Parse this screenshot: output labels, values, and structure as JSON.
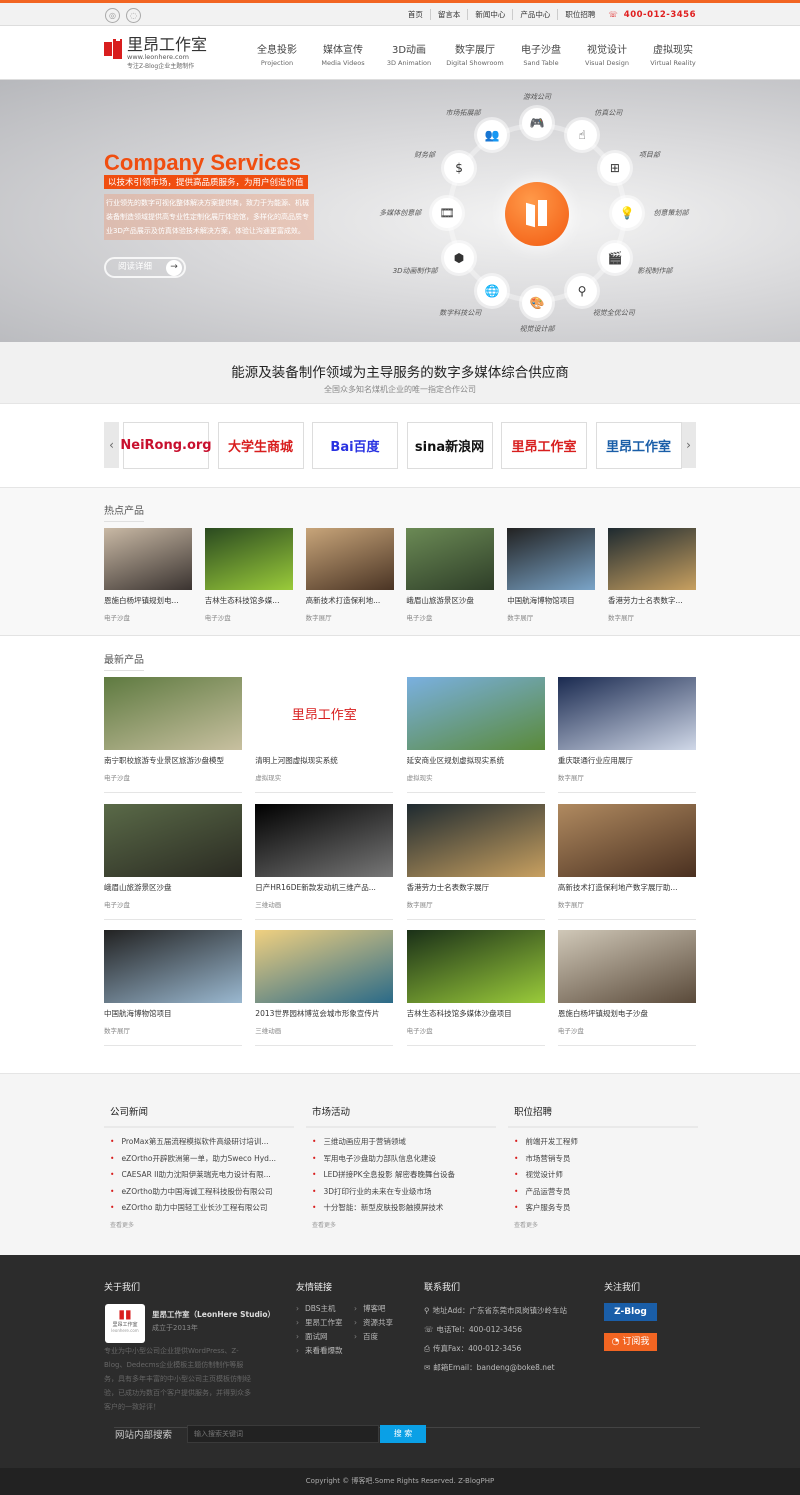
{
  "topbar": {
    "social": [
      {
        "icon": "weibo-icon",
        "glyph": "◎"
      },
      {
        "icon": "wechat-icon",
        "glyph": "◌"
      }
    ],
    "links": [
      "首页",
      "留言本",
      "新闻中心",
      "产品中心",
      "职位招聘"
    ],
    "phone_icon": "phone-icon",
    "phone": "400-012-3456"
  },
  "header": {
    "logo": {
      "name": "里昂工作室",
      "url": "www.leonhere.com",
      "tagline": "专注Z-Blog企业主题制作"
    },
    "nav": [
      {
        "zh": "全息投影",
        "en": "Projection"
      },
      {
        "zh": "媒体宣传",
        "en": "Media Videos"
      },
      {
        "zh": "3D动画",
        "en": "3D Animation"
      },
      {
        "zh": "数字展厅",
        "en": "Digital Showroom"
      },
      {
        "zh": "电子沙盘",
        "en": "Sand Table"
      },
      {
        "zh": "视觉设计",
        "en": "Visual Design"
      },
      {
        "zh": "虚拟现实",
        "en": "Virtual Reality"
      }
    ]
  },
  "banner": {
    "title": "Company Services",
    "subtitle": "以技术引领市场，提供高品质服务，为用户创造价值",
    "description": "行业领先的数字可视化整体解决方案提供商，致力于为能源、机械装备制造领域提供高专业性定制化展厅体验馆，多样化的高品质专业3D产品展示及仿真体验技术解决方案，体验让沟通更富成效。",
    "read_more": "阅读详细",
    "nodes": [
      {
        "label": "游戏公司",
        "icon": "gamepad-icon",
        "glyph": "🎮"
      },
      {
        "label": "仿真公司",
        "icon": "hand-pointer-icon",
        "glyph": "☝"
      },
      {
        "label": "项目部",
        "icon": "org-chart-icon",
        "glyph": "⊞"
      },
      {
        "label": "创意策划部",
        "icon": "lightbulb-icon",
        "glyph": "💡"
      },
      {
        "label": "影视制作部",
        "icon": "clapperboard-icon",
        "glyph": "🎬"
      },
      {
        "label": "视觉全优公司",
        "icon": "search-person-icon",
        "glyph": "⚲"
      },
      {
        "label": "视觉设计部",
        "icon": "palette-icon",
        "glyph": "🎨"
      },
      {
        "label": "数字科技公司",
        "icon": "globe-truck-icon",
        "glyph": "🌐"
      },
      {
        "label": "3D动画制作部",
        "icon": "cube-icon",
        "glyph": "⬢"
      },
      {
        "label": "多媒体创意部",
        "icon": "film-reel-icon",
        "glyph": "🎞"
      },
      {
        "label": "财务部",
        "icon": "money-bag-icon",
        "glyph": "$"
      },
      {
        "label": "市场拓展部",
        "icon": "people-chart-icon",
        "glyph": "👥"
      }
    ]
  },
  "slogan": {
    "heading": "能源及装备制作领域为主导服务的数字多媒体综合供应商",
    "sub": "全国众多知名煤机企业的唯一指定合作公司"
  },
  "partners": {
    "prev": "‹",
    "next": "›",
    "logos": [
      {
        "name": "NeiRong.org",
        "color": "#c8102e"
      },
      {
        "name": "大学生商城",
        "color": "#d81e1e"
      },
      {
        "name": "Bai百度",
        "color": "#2932e1"
      },
      {
        "name": "sina新浪网",
        "color": "#111"
      },
      {
        "name": "里昂工作室",
        "color": "#d81e1e"
      },
      {
        "name": "里昂工作室",
        "color": "#1a5ea8"
      }
    ]
  },
  "hot": {
    "title": "热点产品",
    "items": [
      {
        "title": "恩施白杨坪镇规划电...",
        "category": "电子沙盘",
        "colors": [
          "#c9b9a5",
          "#3a3330"
        ]
      },
      {
        "title": "吉林生态科技馆多媒...",
        "category": "电子沙盘",
        "colors": [
          "#2a4a20",
          "#9acb3a"
        ]
      },
      {
        "title": "高新技术打造保利地...",
        "category": "数字展厅",
        "colors": [
          "#c8a57a",
          "#4a3424"
        ]
      },
      {
        "title": "峨眉山旅游景区沙盘",
        "category": "电子沙盘",
        "colors": [
          "#6b8a55",
          "#2e3e28"
        ]
      },
      {
        "title": "中国航海博物馆项目",
        "category": "数字展厅",
        "colors": [
          "#222",
          "#7aa4c8"
        ]
      },
      {
        "title": "香港劳力士名表数字...",
        "category": "数字展厅",
        "colors": [
          "#1e2a30",
          "#c8a060"
        ]
      }
    ]
  },
  "latest": {
    "title": "最新产品",
    "items": [
      {
        "title": "南宁职校旅游专业景区旅游沙盘模型",
        "category": "电子沙盘",
        "colors": [
          "#5e7a40",
          "#c8c0a0"
        ]
      },
      {
        "title": "清明上河图虚拟现实系统",
        "category": "虚拟现实",
        "colors": [
          "#ffffff",
          "#ffffff"
        ],
        "logo": true
      },
      {
        "title": "延安商业区规划虚拟现实系统",
        "category": "虚拟现实",
        "colors": [
          "#7ab0e0",
          "#5a8a3a"
        ]
      },
      {
        "title": "重庆联通行业应用展厅",
        "category": "数字展厅",
        "colors": [
          "#1a2a50",
          "#d0d8e8"
        ]
      },
      {
        "title": "峨眉山旅游景区沙盘",
        "category": "电子沙盘",
        "colors": [
          "#5a6a48",
          "#2a2a22"
        ]
      },
      {
        "title": "日产HR16DE新款发动机三维产品...",
        "category": "三维动画",
        "colors": [
          "#000",
          "#777"
        ]
      },
      {
        "title": "香港劳力士名表数字展厅",
        "category": "数字展厅",
        "colors": [
          "#1e2a30",
          "#c8a060"
        ]
      },
      {
        "title": "高新技术打造保利地产数字展厅助...",
        "category": "数字展厅",
        "colors": [
          "#b08a60",
          "#4a3020"
        ]
      },
      {
        "title": "中国航海博物馆项目",
        "category": "数字展厅",
        "colors": [
          "#222",
          "#9ab8d0"
        ]
      },
      {
        "title": "2013世界园林博览会城市形象宣传片",
        "category": "三维动画",
        "colors": [
          "#f0d080",
          "#2a6a88"
        ]
      },
      {
        "title": "吉林生态科技馆多媒体沙盘项目",
        "category": "电子沙盘",
        "colors": [
          "#1a3018",
          "#9acb3a"
        ]
      },
      {
        "title": "恩施白杨坪镇规划电子沙盘",
        "category": "电子沙盘",
        "colors": [
          "#d0c8b8",
          "#5a4a3a"
        ]
      }
    ]
  },
  "news": {
    "more": "查看更多",
    "columns": [
      {
        "title": "公司新闻",
        "items": [
          "ProMax第五届流程模拟软件高级研讨培训...",
          "eZOrtho开辟欧洲第一单，助力Sweco Hyd...",
          "CAESAR II助力沈阳伊莱瑞克电力设计有限...",
          "eZOrtho助力中国海诚工程科技股份有限公司",
          "eZOrtho 助力中国轻工业长沙工程有限公司"
        ]
      },
      {
        "title": "市场活动",
        "items": [
          "三维动画应用于营销领域",
          "军用电子沙盘助力部队信息化建设",
          "LED拼接PK全息投影 解密春晚舞台设备",
          "3D打印行业的未来在专业级市场",
          "十分智能：新型皮肤投影触摸屏技术"
        ]
      },
      {
        "title": "职位招聘",
        "items": [
          "前端开发工程师",
          "市场营销专员",
          "视觉设计师",
          "产品运营专员",
          "客户服务专员"
        ]
      }
    ]
  },
  "footer": {
    "about": {
      "title": "关于我们",
      "name": "里昂工作室（LeonHere Studio）",
      "founded": "成立于2013年",
      "logo_text": "里昂工作室",
      "logo_url": "leonhere.com",
      "text": "专业为中小型公司企业提供WordPress、Z-Blog、Dedecms企业模板主题仿制制作等服务，具有多年丰富的中小型公司主页模板仿制经验，已成功为数百个客户提供服务，并得到众多客户的一致好评！"
    },
    "links": {
      "title": "友情链接",
      "items": [
        "DBS主机",
        "博客吧",
        "里昂工作室",
        "资源共享",
        "面试网",
        "百度",
        "来看看爆款"
      ]
    },
    "contact": {
      "title": "联系我们",
      "items": [
        {
          "icon": "map-pin-icon",
          "glyph": "⚲",
          "text": "地址Add：广东省东莞市凤岗镇沙岭车站"
        },
        {
          "icon": "phone-icon",
          "glyph": "☏",
          "text": "电话Tel：400-012-3456"
        },
        {
          "icon": "fax-icon",
          "glyph": "⎙",
          "text": "传真Fax：400-012-3456"
        },
        {
          "icon": "mail-icon",
          "glyph": "✉",
          "text": "邮箱Email：bandeng@boke8.net"
        }
      ]
    },
    "follow": {
      "title": "关注我们",
      "zblog": "Z-Blog",
      "rss": "订阅我"
    },
    "search": {
      "label": "网站内部搜索",
      "placeholder": "输入搜索关键词",
      "button": "搜 索"
    },
    "copyright": "Copyright © 博客吧.Some Rights Reserved. Z-BlogPHP"
  },
  "colors": {
    "accent": "#f04e10",
    "brand_red": "#d81e1e",
    "phone": "#e02020",
    "search_button": "#0aa0e6",
    "footer_bg": "#2c2c2c"
  }
}
